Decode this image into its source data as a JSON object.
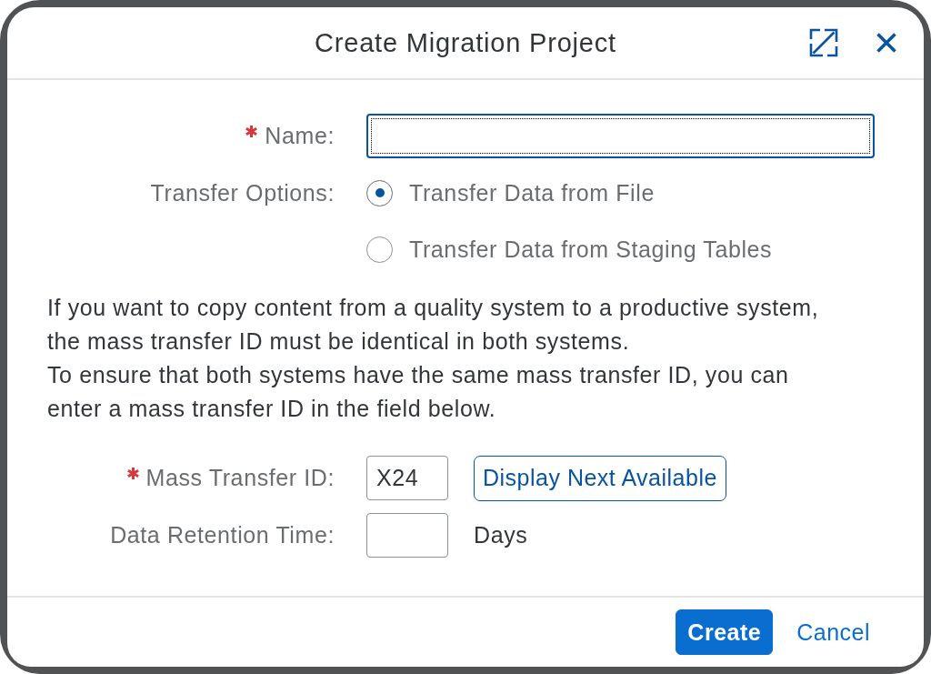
{
  "dialog": {
    "title": "Create Migration Project"
  },
  "name_field": {
    "label": "Name:",
    "required": true,
    "focused": true
  },
  "transfer_options": {
    "label": "Transfer Options:",
    "options": [
      {
        "label": "Transfer Data from File",
        "selected": true
      },
      {
        "label": "Transfer Data from Staging Tables",
        "selected": false
      }
    ]
  },
  "info_text": [
    "If you want to copy content from a quality system to a productive system, the mass transfer ID must be identical in both systems.",
    "To ensure that both systems have the same mass transfer ID, you can enter a mass transfer ID in the field below."
  ],
  "mass_transfer_id": {
    "label": "Mass Transfer ID:",
    "required": true,
    "value": "X24",
    "button": "Display Next Available"
  },
  "data_retention_time": {
    "label": "Data Retention Time:",
    "unit": "Days"
  },
  "footer_buttons": [
    {
      "label": "Create",
      "kind": "emphasized"
    },
    {
      "label": "Cancel",
      "kind": "transparent"
    }
  ]
}
